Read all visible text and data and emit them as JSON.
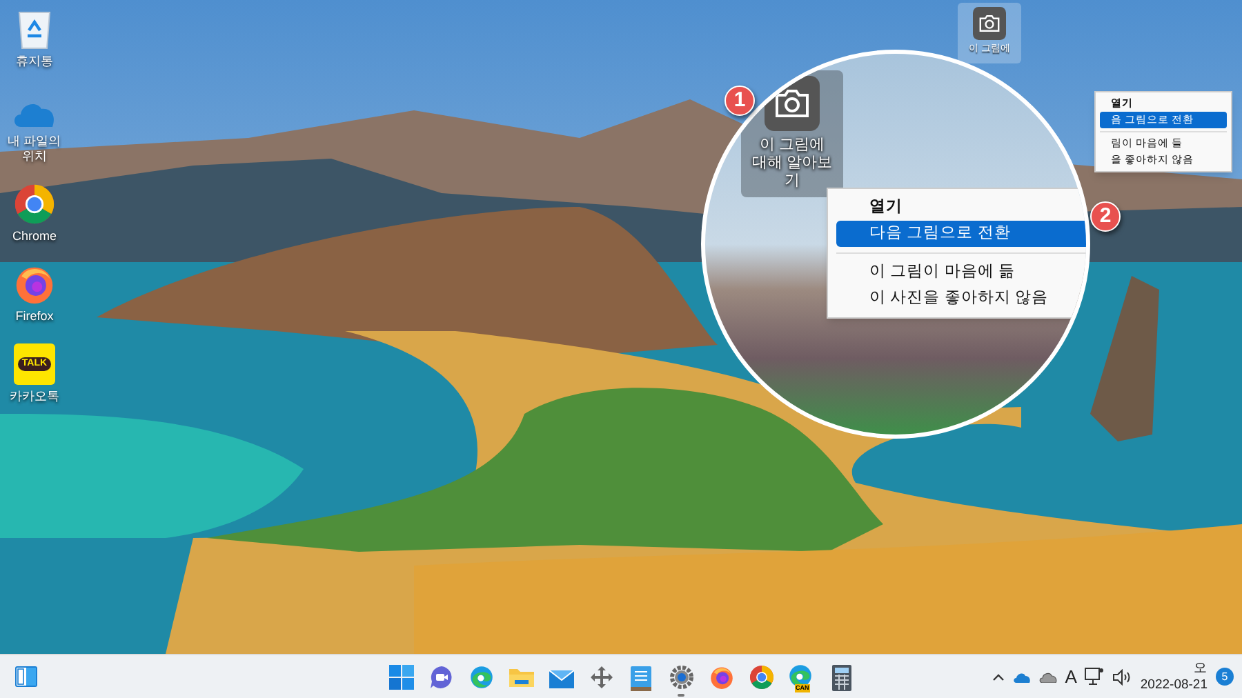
{
  "desktop_icons": [
    {
      "kind": "recycle",
      "label": "휴지통"
    },
    {
      "kind": "onedrive",
      "label": "내 파일의 위치"
    },
    {
      "kind": "chrome",
      "label": "Chrome"
    },
    {
      "kind": "firefox",
      "label": "Firefox"
    },
    {
      "kind": "talk",
      "label": "카카오톡",
      "logo_text": "TALK"
    }
  ],
  "spotlight_widget": {
    "label": "이 그림에"
  },
  "context_menu": {
    "items": [
      {
        "label": "열기",
        "kind": "bold",
        "selected": false
      },
      {
        "label": "음 그림으로 전환",
        "kind": "item",
        "selected": true
      },
      {
        "kind": "separator"
      },
      {
        "label": "림이 마음에 들",
        "kind": "item",
        "selected": false
      },
      {
        "label": "을 좋아하지 않음",
        "kind": "item",
        "selected": false
      }
    ]
  },
  "magnifier": {
    "widget_label": "이 그림에 대해 알아보기",
    "menu_items": [
      {
        "label": "열기",
        "kind": "bold",
        "selected": false
      },
      {
        "label": "다음 그림으로 전환",
        "kind": "item",
        "selected": true
      },
      {
        "kind": "separator"
      },
      {
        "label": "이 그림이 마음에 듦",
        "kind": "item",
        "selected": false
      },
      {
        "label": "이 사진을 좋아하지 않음",
        "kind": "item",
        "selected": false
      }
    ]
  },
  "step_markers": [
    {
      "number": "1"
    },
    {
      "number": "2"
    }
  ],
  "taskbar": {
    "apps": [
      {
        "kind": "start",
        "running": false
      },
      {
        "kind": "chat",
        "running": false
      },
      {
        "kind": "edge",
        "running": false
      },
      {
        "kind": "folder",
        "running": false
      },
      {
        "kind": "mail",
        "running": false
      },
      {
        "kind": "move",
        "running": false
      },
      {
        "kind": "notepad",
        "running": false
      },
      {
        "kind": "settings",
        "running": true
      },
      {
        "kind": "firefox",
        "running": false
      },
      {
        "kind": "chrome",
        "running": false
      },
      {
        "kind": "edge-canary",
        "running": false,
        "tag": "CAN"
      },
      {
        "kind": "calculator",
        "running": false
      }
    ],
    "tray": {
      "ime": "A",
      "time": "오",
      "date": "2022-08-21",
      "notification_count": "5"
    }
  }
}
